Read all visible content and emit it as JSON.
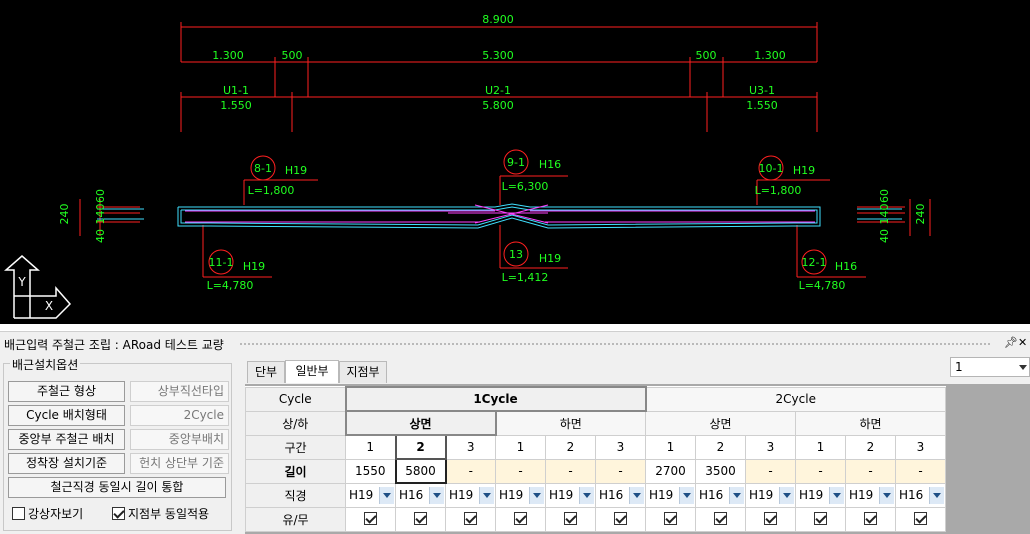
{
  "drawing": {
    "total_dim": "8.900",
    "dim_row1": [
      "1.300",
      "500",
      "5.300",
      "500",
      "1.300"
    ],
    "section_names": [
      "U1-1",
      "U2-1",
      "U3-1"
    ],
    "section_lengths": [
      "1.550",
      "5.800",
      "1.550"
    ],
    "left_heights": [
      "60",
      "140",
      "40",
      "240"
    ],
    "right_heights": [
      "60",
      "140",
      "40",
      "240"
    ],
    "tags": [
      {
        "id": "8-1",
        "dia": "H19",
        "len": "L=1,800"
      },
      {
        "id": "9-1",
        "dia": "H16",
        "len": "L=6,300"
      },
      {
        "id": "10-1",
        "dia": "H19",
        "len": "L=1,800"
      },
      {
        "id": "11-1",
        "dia": "H19",
        "len": "L=4,780"
      },
      {
        "id": "13",
        "dia": "H19",
        "len": "L=1,412"
      },
      {
        "id": "12-1",
        "dia": "H16",
        "len": "L=4,780"
      }
    ],
    "axis_y": "Y",
    "axis_x": "X",
    "colors": {
      "dim": "#ff2020",
      "text": "#20ff20",
      "rebar": "#ff40ff",
      "slab": "#40e0ff"
    }
  },
  "panel": {
    "title": "배근입력 주철근 조립 : ARoad 테스트 교량",
    "pin_icon": "pin-icon",
    "close_icon": "close-icon"
  },
  "options": {
    "group_label": "배근설치옵션",
    "rows": [
      {
        "label": "주철근 형상",
        "value": "상부직선타입"
      },
      {
        "label": "Cycle 배치형태",
        "value": "2Cycle"
      },
      {
        "label": "중앙부 주철근 배치",
        "value": "중앙부배치"
      },
      {
        "label": "정착장 설치기준",
        "value": "헌치 상단부 기준"
      }
    ],
    "merge_button": "철근직경 동일시 길이 통합",
    "check_left": {
      "label": "강상자보기",
      "checked": false
    },
    "check_right": {
      "label": "지점부 동일적용",
      "checked": true
    }
  },
  "tabs": [
    "단부",
    "일반부",
    "지점부"
  ],
  "active_tab": 1,
  "combo_value": "1",
  "grid": {
    "row_headers": [
      "Cycle",
      "상/하",
      "구간",
      "길이",
      "직경",
      "유/무"
    ],
    "cycles": [
      "1Cycle",
      "2Cycle"
    ],
    "faces": [
      "상면",
      "하면",
      "상면",
      "하면"
    ],
    "sections": [
      "1",
      "2",
      "3",
      "1",
      "2",
      "3",
      "1",
      "2",
      "3",
      "1",
      "2",
      "3"
    ],
    "lengths": [
      "1550",
      "5800",
      "-",
      "-",
      "-",
      "-",
      "2700",
      "3500",
      "-",
      "-",
      "-",
      "-"
    ],
    "diameters": [
      "H19",
      "H16",
      "H19",
      "H19",
      "H19",
      "H16",
      "H19",
      "H16",
      "H19",
      "H19",
      "H19",
      "H16"
    ],
    "enabled": [
      true,
      true,
      true,
      true,
      true,
      true,
      true,
      true,
      true,
      true,
      true,
      true
    ]
  }
}
